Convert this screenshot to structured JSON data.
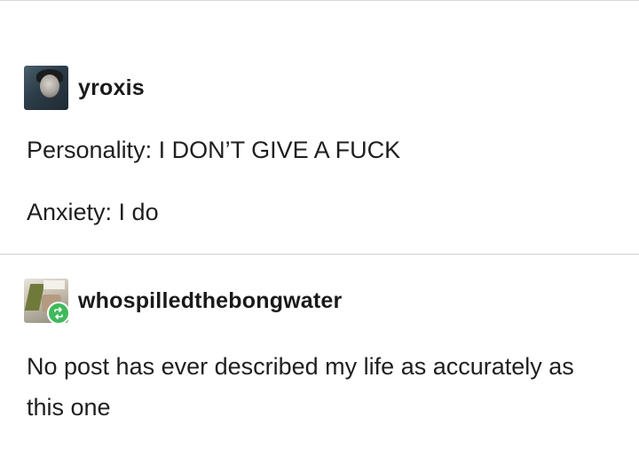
{
  "posts": [
    {
      "username": "yroxis",
      "lines": [
        "Personality: I DON’T GIVE A FUCK",
        "Anxiety: I do"
      ]
    },
    {
      "username": "whospilledthebongwater",
      "reblog_icon": "reblog-icon",
      "body": "No post has ever described my life as accurately as this one"
    }
  ]
}
